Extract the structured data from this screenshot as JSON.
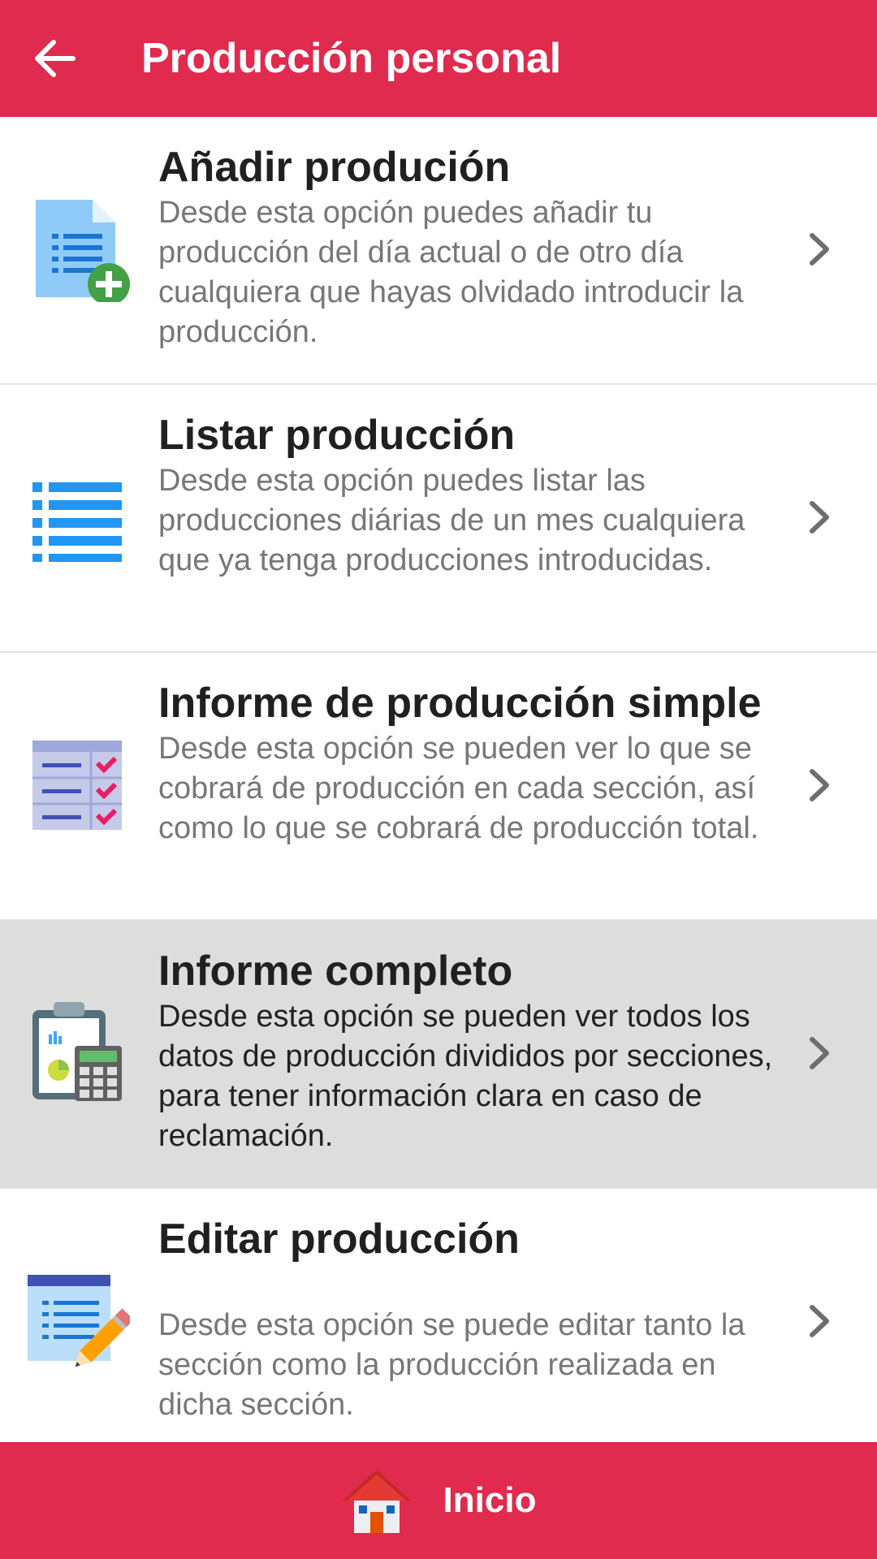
{
  "header": {
    "title": "Producción personal",
    "back_icon": "arrow-left-icon"
  },
  "colors": {
    "primary": "#E02A4E",
    "selected_row": "#dddddd"
  },
  "menu": {
    "items": [
      {
        "title": "Añadir produción",
        "description": "Desde esta opción puedes añadir tu producción del día actual o de otro día cualquiera que hayas olvidado introducir la producción.",
        "icon": "add-document-icon",
        "selected": false
      },
      {
        "title": "Listar producción",
        "description": "Desde esta opción puedes listar las producciones diárias de un mes cualquiera que ya tenga producciones introducidas.",
        "icon": "list-icon",
        "selected": false
      },
      {
        "title": "Informe de producción simple",
        "description": "Desde esta opción se pueden ver lo que se cobrará de producción en cada sección, así como lo que se cobrará de producción total.",
        "icon": "checklist-icon",
        "selected": false
      },
      {
        "title": "Informe completo",
        "description": "Desde esta opción se pueden ver todos los datos de producción divididos por secciones, para tener información clara en caso de reclamación.",
        "icon": "clipboard-calculator-icon",
        "selected": true
      },
      {
        "title": "Editar producción",
        "description": "Desde esta opción se puede editar tanto la sección como la producción realizada en dicha sección.",
        "icon": "edit-document-icon",
        "selected": false
      }
    ]
  },
  "bottom_nav": {
    "label": "Inicio",
    "icon": "home-icon"
  }
}
